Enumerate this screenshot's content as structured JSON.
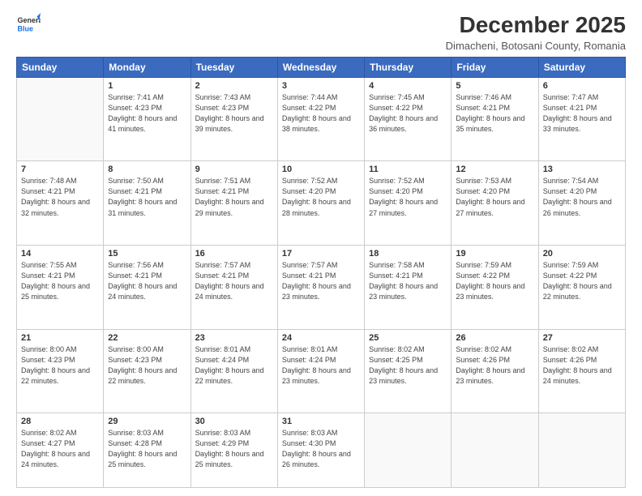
{
  "logo": {
    "line1": "General",
    "line2": "Blue"
  },
  "header": {
    "title": "December 2025",
    "subtitle": "Dimacheni, Botosani County, Romania"
  },
  "days_of_week": [
    "Sunday",
    "Monday",
    "Tuesday",
    "Wednesday",
    "Thursday",
    "Friday",
    "Saturday"
  ],
  "weeks": [
    [
      {
        "day": "",
        "sunrise": "",
        "sunset": "",
        "daylight": "",
        "empty": true
      },
      {
        "day": "1",
        "sunrise": "Sunrise: 7:41 AM",
        "sunset": "Sunset: 4:23 PM",
        "daylight": "Daylight: 8 hours and 41 minutes."
      },
      {
        "day": "2",
        "sunrise": "Sunrise: 7:43 AM",
        "sunset": "Sunset: 4:23 PM",
        "daylight": "Daylight: 8 hours and 39 minutes."
      },
      {
        "day": "3",
        "sunrise": "Sunrise: 7:44 AM",
        "sunset": "Sunset: 4:22 PM",
        "daylight": "Daylight: 8 hours and 38 minutes."
      },
      {
        "day": "4",
        "sunrise": "Sunrise: 7:45 AM",
        "sunset": "Sunset: 4:22 PM",
        "daylight": "Daylight: 8 hours and 36 minutes."
      },
      {
        "day": "5",
        "sunrise": "Sunrise: 7:46 AM",
        "sunset": "Sunset: 4:21 PM",
        "daylight": "Daylight: 8 hours and 35 minutes."
      },
      {
        "day": "6",
        "sunrise": "Sunrise: 7:47 AM",
        "sunset": "Sunset: 4:21 PM",
        "daylight": "Daylight: 8 hours and 33 minutes."
      }
    ],
    [
      {
        "day": "7",
        "sunrise": "Sunrise: 7:48 AM",
        "sunset": "Sunset: 4:21 PM",
        "daylight": "Daylight: 8 hours and 32 minutes."
      },
      {
        "day": "8",
        "sunrise": "Sunrise: 7:50 AM",
        "sunset": "Sunset: 4:21 PM",
        "daylight": "Daylight: 8 hours and 31 minutes."
      },
      {
        "day": "9",
        "sunrise": "Sunrise: 7:51 AM",
        "sunset": "Sunset: 4:21 PM",
        "daylight": "Daylight: 8 hours and 29 minutes."
      },
      {
        "day": "10",
        "sunrise": "Sunrise: 7:52 AM",
        "sunset": "Sunset: 4:20 PM",
        "daylight": "Daylight: 8 hours and 28 minutes."
      },
      {
        "day": "11",
        "sunrise": "Sunrise: 7:52 AM",
        "sunset": "Sunset: 4:20 PM",
        "daylight": "Daylight: 8 hours and 27 minutes."
      },
      {
        "day": "12",
        "sunrise": "Sunrise: 7:53 AM",
        "sunset": "Sunset: 4:20 PM",
        "daylight": "Daylight: 8 hours and 27 minutes."
      },
      {
        "day": "13",
        "sunrise": "Sunrise: 7:54 AM",
        "sunset": "Sunset: 4:20 PM",
        "daylight": "Daylight: 8 hours and 26 minutes."
      }
    ],
    [
      {
        "day": "14",
        "sunrise": "Sunrise: 7:55 AM",
        "sunset": "Sunset: 4:21 PM",
        "daylight": "Daylight: 8 hours and 25 minutes."
      },
      {
        "day": "15",
        "sunrise": "Sunrise: 7:56 AM",
        "sunset": "Sunset: 4:21 PM",
        "daylight": "Daylight: 8 hours and 24 minutes."
      },
      {
        "day": "16",
        "sunrise": "Sunrise: 7:57 AM",
        "sunset": "Sunset: 4:21 PM",
        "daylight": "Daylight: 8 hours and 24 minutes."
      },
      {
        "day": "17",
        "sunrise": "Sunrise: 7:57 AM",
        "sunset": "Sunset: 4:21 PM",
        "daylight": "Daylight: 8 hours and 23 minutes."
      },
      {
        "day": "18",
        "sunrise": "Sunrise: 7:58 AM",
        "sunset": "Sunset: 4:21 PM",
        "daylight": "Daylight: 8 hours and 23 minutes."
      },
      {
        "day": "19",
        "sunrise": "Sunrise: 7:59 AM",
        "sunset": "Sunset: 4:22 PM",
        "daylight": "Daylight: 8 hours and 23 minutes."
      },
      {
        "day": "20",
        "sunrise": "Sunrise: 7:59 AM",
        "sunset": "Sunset: 4:22 PM",
        "daylight": "Daylight: 8 hours and 22 minutes."
      }
    ],
    [
      {
        "day": "21",
        "sunrise": "Sunrise: 8:00 AM",
        "sunset": "Sunset: 4:23 PM",
        "daylight": "Daylight: 8 hours and 22 minutes."
      },
      {
        "day": "22",
        "sunrise": "Sunrise: 8:00 AM",
        "sunset": "Sunset: 4:23 PM",
        "daylight": "Daylight: 8 hours and 22 minutes."
      },
      {
        "day": "23",
        "sunrise": "Sunrise: 8:01 AM",
        "sunset": "Sunset: 4:24 PM",
        "daylight": "Daylight: 8 hours and 22 minutes."
      },
      {
        "day": "24",
        "sunrise": "Sunrise: 8:01 AM",
        "sunset": "Sunset: 4:24 PM",
        "daylight": "Daylight: 8 hours and 23 minutes."
      },
      {
        "day": "25",
        "sunrise": "Sunrise: 8:02 AM",
        "sunset": "Sunset: 4:25 PM",
        "daylight": "Daylight: 8 hours and 23 minutes."
      },
      {
        "day": "26",
        "sunrise": "Sunrise: 8:02 AM",
        "sunset": "Sunset: 4:26 PM",
        "daylight": "Daylight: 8 hours and 23 minutes."
      },
      {
        "day": "27",
        "sunrise": "Sunrise: 8:02 AM",
        "sunset": "Sunset: 4:26 PM",
        "daylight": "Daylight: 8 hours and 24 minutes."
      }
    ],
    [
      {
        "day": "28",
        "sunrise": "Sunrise: 8:02 AM",
        "sunset": "Sunset: 4:27 PM",
        "daylight": "Daylight: 8 hours and 24 minutes."
      },
      {
        "day": "29",
        "sunrise": "Sunrise: 8:03 AM",
        "sunset": "Sunset: 4:28 PM",
        "daylight": "Daylight: 8 hours and 25 minutes."
      },
      {
        "day": "30",
        "sunrise": "Sunrise: 8:03 AM",
        "sunset": "Sunset: 4:29 PM",
        "daylight": "Daylight: 8 hours and 25 minutes."
      },
      {
        "day": "31",
        "sunrise": "Sunrise: 8:03 AM",
        "sunset": "Sunset: 4:30 PM",
        "daylight": "Daylight: 8 hours and 26 minutes."
      },
      {
        "day": "",
        "sunrise": "",
        "sunset": "",
        "daylight": "",
        "empty": true
      },
      {
        "day": "",
        "sunrise": "",
        "sunset": "",
        "daylight": "",
        "empty": true
      },
      {
        "day": "",
        "sunrise": "",
        "sunset": "",
        "daylight": "",
        "empty": true
      }
    ]
  ]
}
